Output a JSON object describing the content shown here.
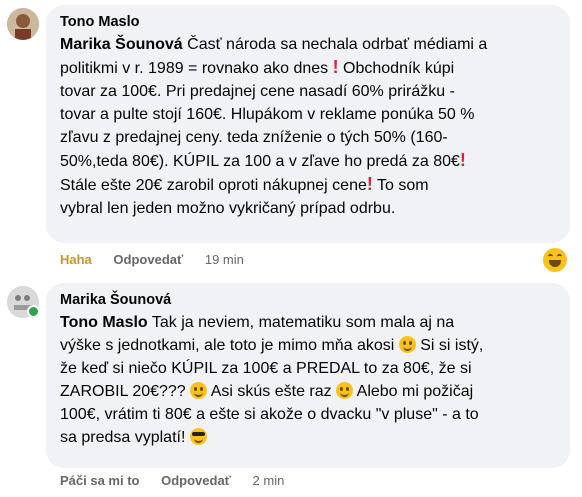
{
  "comments": [
    {
      "author": "Tono Maslo",
      "mention": "Marika Šounová",
      "lines": [
        " Časť národa sa nechala odrbať médiami a",
        "politikmi v r. 1989 = rovnako ako dnes ",
        " Obchodník kúpi",
        "tovar za 100€. Pri predajnej cene nasadí 60% prirážku -",
        "tovar a pulte stojí 160€. Hlupákom v reklame ponúka 50 %",
        "zľavu z predajnej ceny. teda zníženie o tých 50% (160-",
        "50%,teda 80€). KÚPIL za 100 a v zľave ho predá za 80€",
        "Stále ešte 20€ zarobil oproti nákupnej cene",
        " To som",
        "vybral len jeden možno vykričaný prípad odrbu."
      ],
      "actions": {
        "reaction": "Haha",
        "reply": "Odpovedať",
        "time": "19 min"
      }
    },
    {
      "author": "Marika Šounová",
      "mention": "Tono Maslo",
      "lines": [
        " Tak ja neviem, matematiku som mala aj na",
        "výške s jednotkami, ale toto je mimo mňa akosi ",
        " Si si istý,",
        "že keď si niečo KÚPIL za 100€ a PREDAL to za 80€, že si",
        "ZAROBIL 20€??? ",
        " Asi skús ešte raz ",
        " Alebo mi požičaj",
        "100€, vrátim ti 80€ a ešte si akože o dvacku \"v pluse\" - a to",
        "sa predsa vyplatí! "
      ],
      "actions": {
        "reaction": "Páči sa mi to",
        "reply": "Odpovedať",
        "time": "2 min"
      }
    }
  ],
  "icons": {
    "exclamation": "red-exclamation-emoji",
    "smile": "smiling-face-emoji",
    "cool": "sunglasses-face-emoji",
    "haha_reaction": "laughing-face-icon"
  },
  "colors": {
    "bubble": "#f0f2f5",
    "haha": "#c9962b",
    "meta": "#65676b",
    "exclamation": "#e41e3f"
  }
}
